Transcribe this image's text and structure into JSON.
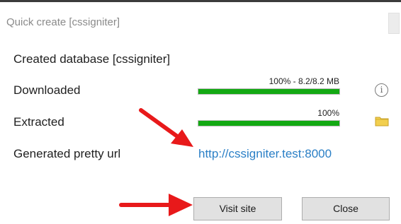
{
  "window": {
    "title": "Quick create [cssigniter]"
  },
  "rows": {
    "created": "Created database [cssigniter]",
    "downloaded_label": "Downloaded",
    "downloaded_progress_text": "100%  -  8.2/8.2 MB",
    "downloaded_progress": 1.0,
    "extracted_label": "Extracted",
    "extracted_progress_text": "100%",
    "extracted_progress": 1.0,
    "url_label": "Generated pretty url",
    "url_value": "http://cssigniter.test:8000"
  },
  "icons": {
    "info": "info-icon",
    "info_glyph": "i",
    "folder": "folder-icon"
  },
  "buttons": {
    "visit_site": "Visit site",
    "close": "Close"
  },
  "colors": {
    "progress_fill": "#13a913",
    "link": "#2a7fc6",
    "arrow": "#e8191a",
    "folder": "#f2cf4e"
  }
}
